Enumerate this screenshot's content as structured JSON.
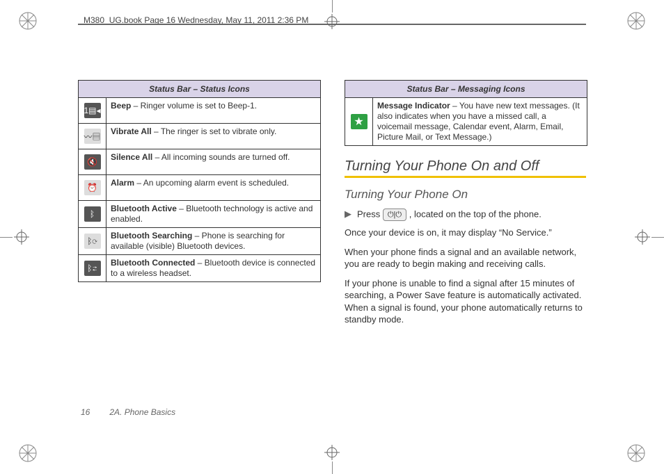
{
  "header": "M380_UG.book  Page 16  Wednesday, May 11, 2011  2:36 PM",
  "leftTable": {
    "title": "Status Bar – Status Icons",
    "rows": [
      {
        "icon": "beep-icon",
        "iconGlyph": "1▤◂",
        "bold": "Beep",
        "text": " – Ringer volume is set to Beep-1."
      },
      {
        "icon": "vibrate-icon",
        "iconGlyph": "〰▤",
        "bold": "Vibrate All",
        "text": " – The ringer is set to vibrate only."
      },
      {
        "icon": "silence-icon",
        "iconGlyph": "🔇",
        "bold": "Silence All",
        "text": " – All incoming sounds are turned off."
      },
      {
        "icon": "alarm-icon",
        "iconGlyph": "⏰",
        "bold": "Alarm",
        "text": " – An upcoming alarm event is scheduled."
      },
      {
        "icon": "bt-active-icon",
        "iconGlyph": "ᛒ",
        "bold": "Bluetooth Active",
        "text": " – Bluetooth technology is active and enabled."
      },
      {
        "icon": "bt-search-icon",
        "iconGlyph": "ᛒ⟳",
        "bold": "Bluetooth Searching",
        "text": " – Phone is searching for available (visible) Bluetooth devices."
      },
      {
        "icon": "bt-connected-icon",
        "iconGlyph": "ᛒ⇄",
        "bold": "Bluetooth Connected",
        "text": " – Bluetooth device is connected to a wireless headset."
      }
    ]
  },
  "rightTable": {
    "title": "Status Bar – Messaging Icons",
    "rows": [
      {
        "icon": "message-icon",
        "iconGlyph": "★",
        "bold": "Message Indicator",
        "text": " – You have new text messages. (It also indicates when you have a missed call, a voicemail message, Calendar event, Alarm, Email, Picture Mail, or Text Message.)"
      }
    ]
  },
  "section": {
    "h1": "Turning Your Phone On and Off",
    "h2": "Turning Your Phone On",
    "stepPrefix": "Press ",
    "keyLabel": "⏻|⏻",
    "stepSuffix": ", located on the top of the phone.",
    "p1": "Once your device is on, it may display “No Service.”",
    "p2": "When your phone finds a signal and an available network, you are ready to begin making and receiving calls.",
    "p3": "If your phone is unable to find a signal after 15 minutes of searching, a Power Save feature is automatically activated. When a signal is found, your phone automatically returns to standby mode."
  },
  "footer": {
    "page": "16",
    "section": "2A. Phone Basics"
  }
}
